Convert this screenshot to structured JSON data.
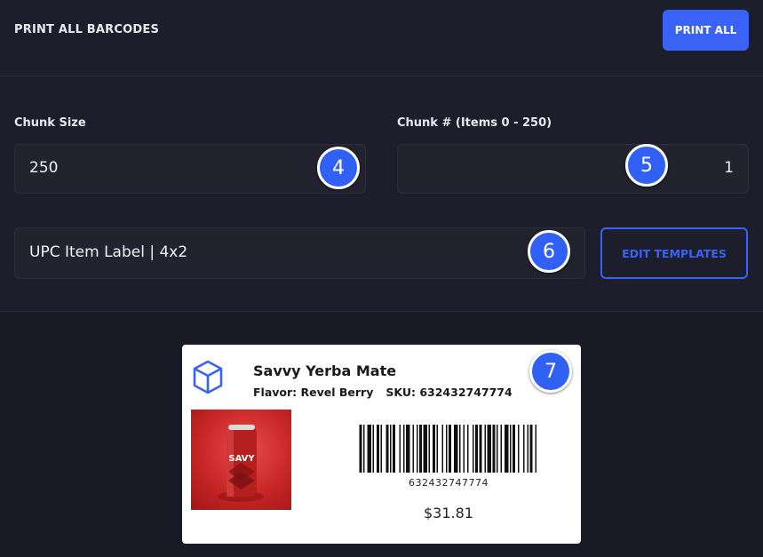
{
  "header": {
    "title": "PRINT ALL BARCODES",
    "print_all_label": "PRINT ALL"
  },
  "form": {
    "chunk_size": {
      "label": "Chunk Size",
      "value": "250"
    },
    "chunk_number": {
      "label": "Chunk # (Items 0 - 250)",
      "value": "1"
    },
    "template": {
      "value": "UPC Item Label | 4x2"
    },
    "edit_templates_label": "EDIT TEMPLATES"
  },
  "markers": [
    "4",
    "5",
    "6",
    "7"
  ],
  "label_preview": {
    "product_name": "Savvy Yerba Mate",
    "flavor": "Flavor: Revel Berry",
    "sku": "SKU: 632432747774",
    "upc": "632432747774",
    "price": "$31.81",
    "can_text": "SAVY"
  },
  "colors": {
    "accent": "#3b62f6",
    "background": "#1c1c28",
    "marker": "#3160f4"
  },
  "icons": [
    "cube-icon"
  ]
}
